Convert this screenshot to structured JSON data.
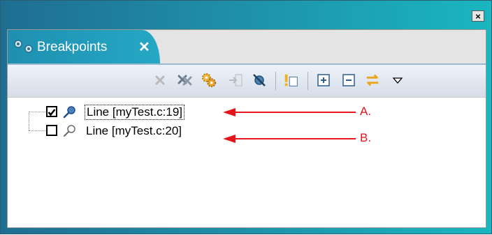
{
  "window": {
    "close_glyph": "×"
  },
  "tab": {
    "label": "Breakpoints",
    "close_glyph": "✕"
  },
  "toolbar": {
    "buttons": [
      {
        "name": "remove-icon",
        "enabled": false
      },
      {
        "name": "remove-all-icon",
        "enabled": true
      },
      {
        "name": "debug-gears-icon",
        "enabled": true
      },
      {
        "name": "go-to-file-icon",
        "enabled": false
      },
      {
        "name": "skip-breakpoints-icon",
        "enabled": true
      },
      {
        "name": "add-breakpoint-icon",
        "enabled": true
      },
      {
        "name": "expand-all-icon",
        "enabled": true
      },
      {
        "name": "collapse-all-icon",
        "enabled": true
      },
      {
        "name": "link-editor-icon",
        "enabled": true
      },
      {
        "name": "view-menu-icon",
        "enabled": true
      }
    ]
  },
  "breakpoints": [
    {
      "label": "Line [myTest.c:19]",
      "checked": true,
      "focused": true
    },
    {
      "label": "Line [myTest.c:20]",
      "checked": false,
      "focused": false
    }
  ],
  "callouts": [
    {
      "label": "A.",
      "color": "#e5141b"
    },
    {
      "label": "B.",
      "color": "#e5141b"
    }
  ]
}
